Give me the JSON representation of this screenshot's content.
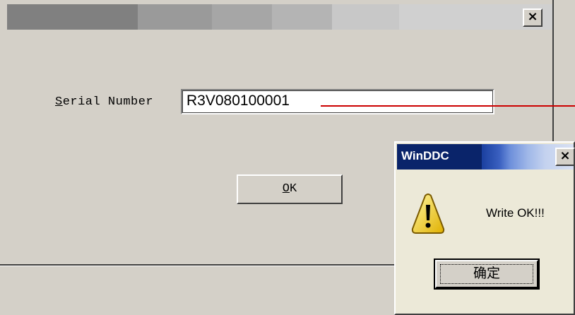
{
  "main_dialog": {
    "close_glyph": "×",
    "serial_label_mnemonic": "S",
    "serial_label_rest": "erial Number",
    "serial_value": "R3V080100001",
    "ok_mnemonic": "O",
    "ok_rest": "K"
  },
  "popup": {
    "title": "WinDDC",
    "close_glyph": "×",
    "message": "Write OK!!!",
    "confirm_label": "确定",
    "icon": "warning-icon"
  },
  "colors": {
    "annotation_line": "#cc0000",
    "popup_title_bar": "#0a246a"
  }
}
